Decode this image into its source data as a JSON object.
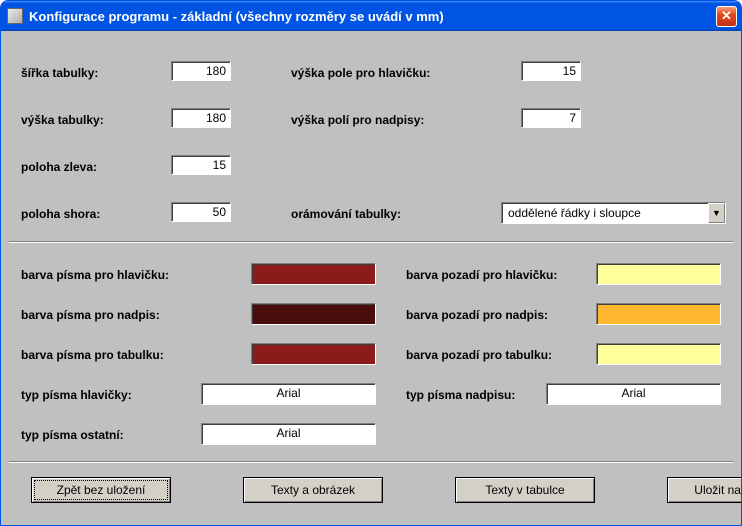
{
  "window": {
    "title": "Konfigurace programu - základní (všechny rozměry se uvádí v mm)"
  },
  "dims": {
    "sirka_tabulky_label": "šířka tabulky:",
    "sirka_tabulky_value": "180",
    "vyska_tabulky_label": "výška tabulky:",
    "vyska_tabulky_value": "180",
    "poloha_zleva_label": "poloha zleva:",
    "poloha_zleva_value": "15",
    "poloha_shora_label": "poloha shora:",
    "poloha_shora_value": "50",
    "vyska_pole_hlavicku_label": "výška pole pro hlavičku:",
    "vyska_pole_hlavicku_value": "15",
    "vyska_poli_nadpisy_label": "výška polí pro nadpisy:",
    "vyska_poli_nadpisy_value": "7",
    "oramovani_label": "orámování tabulky:",
    "oramovani_value": "oddělené řádky i sloupce"
  },
  "colors": {
    "pismo_hlavicku_label": "barva písma pro hlavičku:",
    "pismo_hlavicku_hex": "#8b1a1a",
    "pismo_nadpis_label": "barva písma pro nadpis:",
    "pismo_nadpis_hex": "#4a0d0d",
    "pismo_tabulku_label": "barva písma pro tabulku:",
    "pismo_tabulku_hex": "#8b1a1a",
    "pozadi_hlavicku_label": "barva pozadí pro hlavičku:",
    "pozadi_hlavicku_hex": "#ffff99",
    "pozadi_nadpis_label": "barva pozadí pro nadpis:",
    "pozadi_nadpis_hex": "#ffb732",
    "pozadi_tabulku_label": "barva pozadí pro tabulku:",
    "pozadi_tabulku_hex": "#ffff99"
  },
  "fonts": {
    "typ_hlavicky_label": "typ písma hlavičky:",
    "typ_hlavicky_value": "Arial",
    "typ_nadpisu_label": "typ písma nadpisu:",
    "typ_nadpisu_value": "Arial",
    "typ_ostatni_label": "typ písma ostatní:",
    "typ_ostatni_value": "Arial"
  },
  "buttons": {
    "back": "Zpět bez uložení",
    "texts_img": "Texty a obrázek",
    "texts_table": "Texty v tabulce",
    "save": "Uložit nastavení"
  }
}
